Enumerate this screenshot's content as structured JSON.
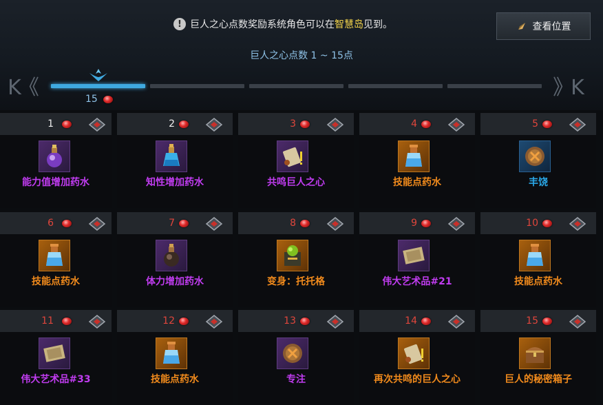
{
  "header": {
    "notice_prefix": "巨人之心点数奖励系统角色可以在",
    "notice_highlight": "智慧岛",
    "notice_suffix": "见到。",
    "location_button": "查看位置",
    "range_label": "巨人之心点数 1 ~ 15点",
    "progress_value": "15",
    "nav_prev": "K《",
    "nav_next": "》K"
  },
  "colors": {
    "accent_blue": "#3fa9e0",
    "claimed_number": "#f0f0f0",
    "locked_number": "#e0463c",
    "grade_purple": "#c03cf0",
    "grade_orange": "#f08a1c",
    "grade_blue": "#2aa8e8"
  },
  "segments": [
    {
      "state": "active"
    },
    {
      "state": "inactive"
    },
    {
      "state": "inactive"
    },
    {
      "state": "inactive"
    },
    {
      "state": "inactive"
    }
  ],
  "rewards": [
    {
      "num": "1",
      "state": "claimed",
      "name": "能力值增加药水",
      "grade": "purple",
      "icon": "purple-flask-icon"
    },
    {
      "num": "2",
      "state": "claimed",
      "name": "知性增加药水",
      "grade": "purple",
      "icon": "blue-flask-icon"
    },
    {
      "num": "3",
      "state": "locked",
      "name": "共鸣巨人之心",
      "grade": "purple",
      "icon": "scroll-icon"
    },
    {
      "num": "4",
      "state": "locked",
      "name": "技能点药水",
      "grade": "orange",
      "icon": "skill-potion-icon"
    },
    {
      "num": "5",
      "state": "locked",
      "name": "丰饶",
      "grade": "blue",
      "icon": "rune-icon"
    },
    {
      "num": "6",
      "state": "locked",
      "name": "技能点药水",
      "grade": "orange",
      "icon": "skill-potion-icon"
    },
    {
      "num": "7",
      "state": "locked",
      "name": "体力增加药水",
      "grade": "purple",
      "icon": "dark-flask-icon"
    },
    {
      "num": "8",
      "state": "locked",
      "name": "变身：托托格",
      "grade": "orange",
      "icon": "transform-box-icon"
    },
    {
      "num": "9",
      "state": "locked",
      "name": "伟大艺术品#21",
      "grade": "purple",
      "icon": "painting-icon"
    },
    {
      "num": "10",
      "state": "locked",
      "name": "技能点药水",
      "grade": "orange",
      "icon": "skill-potion-icon"
    },
    {
      "num": "11",
      "state": "locked",
      "name": "伟大艺术品#33",
      "grade": "purple",
      "icon": "painting-icon"
    },
    {
      "num": "12",
      "state": "locked",
      "name": "技能点药水",
      "grade": "orange",
      "icon": "skill-potion-icon"
    },
    {
      "num": "13",
      "state": "locked",
      "name": "专注",
      "grade": "purple",
      "icon": "rune-icon"
    },
    {
      "num": "14",
      "state": "locked",
      "name": "再次共鸣的巨人之心",
      "grade": "orange",
      "icon": "scroll-icon"
    },
    {
      "num": "15",
      "state": "locked",
      "name": "巨人的秘密箱子",
      "grade": "orange",
      "icon": "chest-icon"
    }
  ]
}
